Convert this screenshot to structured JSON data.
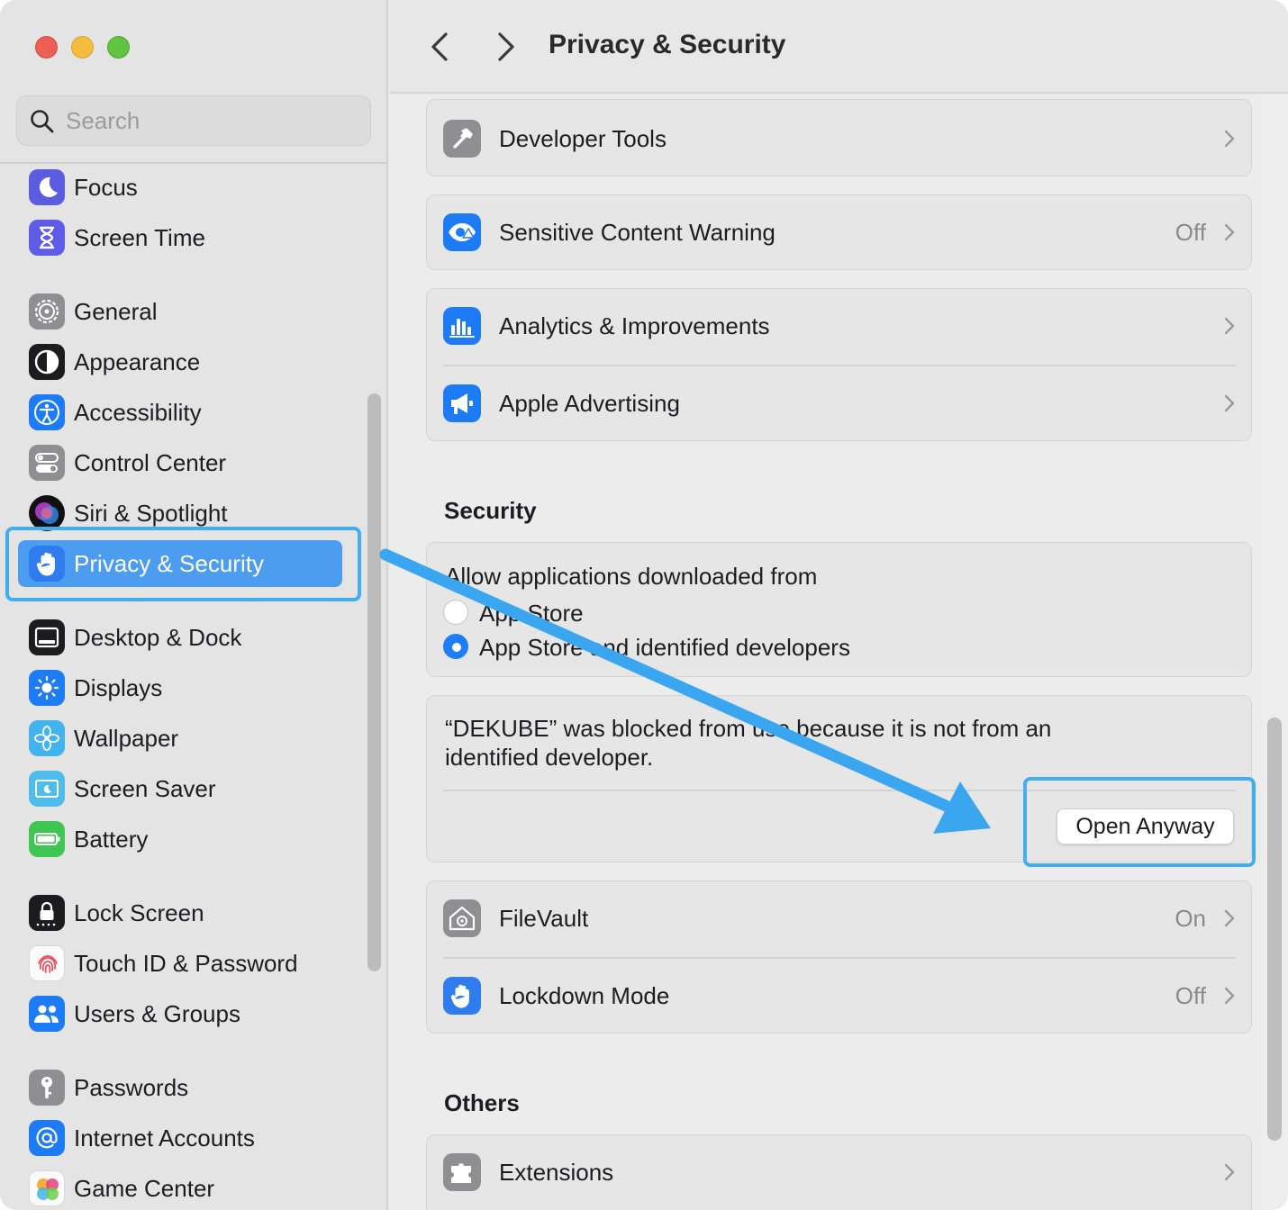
{
  "window": {
    "title": "Privacy & Security",
    "colors": {
      "accent": "#4c9df0",
      "highlight": "#42aef1",
      "radio_on": "#1f7ef5"
    }
  },
  "search": {
    "placeholder": "Search",
    "value": ""
  },
  "sidebar": {
    "items": [
      {
        "label": "Focus",
        "icon": "moon-icon"
      },
      {
        "label": "Screen Time",
        "icon": "hourglass-icon"
      },
      {
        "label": "General",
        "icon": "gear-icon"
      },
      {
        "label": "Appearance",
        "icon": "appearance-icon"
      },
      {
        "label": "Accessibility",
        "icon": "accessibility-icon"
      },
      {
        "label": "Control Center",
        "icon": "toggles-icon"
      },
      {
        "label": "Siri & Spotlight",
        "icon": "siri-icon"
      },
      {
        "label": "Privacy & Security",
        "icon": "hand-icon",
        "selected": true
      },
      {
        "label": "Desktop & Dock",
        "icon": "dock-icon"
      },
      {
        "label": "Displays",
        "icon": "sun-icon"
      },
      {
        "label": "Wallpaper",
        "icon": "flower-icon"
      },
      {
        "label": "Screen Saver",
        "icon": "screensaver-icon"
      },
      {
        "label": "Battery",
        "icon": "battery-icon"
      },
      {
        "label": "Lock Screen",
        "icon": "lock-icon"
      },
      {
        "label": "Touch ID & Password",
        "icon": "fingerprint-icon"
      },
      {
        "label": "Users & Groups",
        "icon": "users-icon"
      },
      {
        "label": "Passwords",
        "icon": "key-icon"
      },
      {
        "label": "Internet Accounts",
        "icon": "at-icon"
      },
      {
        "label": "Game Center",
        "icon": "game-center-icon"
      }
    ]
  },
  "main": {
    "rows": {
      "developer_tools": {
        "label": "Developer Tools"
      },
      "sensitive_content": {
        "label": "Sensitive Content Warning",
        "value": "Off"
      },
      "analytics": {
        "label": "Analytics & Improvements"
      },
      "apple_advertising": {
        "label": "Apple Advertising"
      },
      "filevault": {
        "label": "FileVault",
        "value": "On"
      },
      "lockdown": {
        "label": "Lockdown Mode",
        "value": "Off"
      },
      "extensions": {
        "label": "Extensions"
      }
    },
    "security": {
      "title": "Security",
      "allow_label": "Allow applications downloaded from",
      "options": [
        {
          "label": "App Store",
          "selected": false
        },
        {
          "label": "App Store and identified developers",
          "selected": true
        }
      ],
      "blocked_message": "“DEKUBE” was blocked from use because it is not from an identified developer.",
      "open_anyway": "Open Anyway"
    },
    "others": {
      "title": "Others"
    }
  }
}
